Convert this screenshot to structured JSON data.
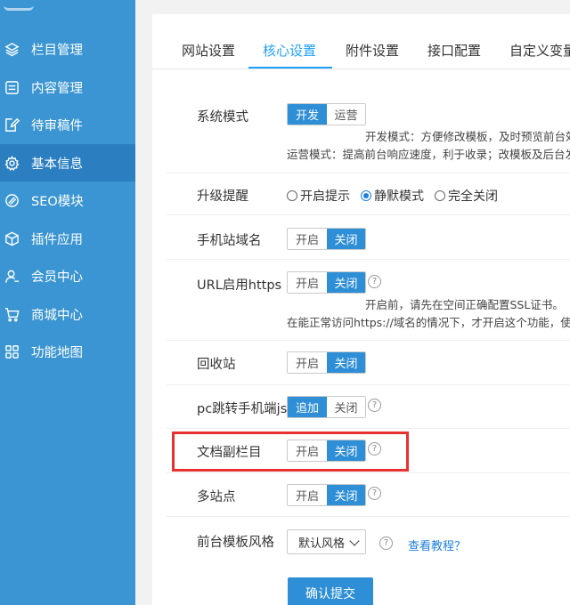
{
  "sidebar": {
    "items": [
      {
        "label": "栏目管理",
        "icon": "layers-icon",
        "active": false
      },
      {
        "label": "内容管理",
        "icon": "list-icon",
        "active": false
      },
      {
        "label": "待审稿件",
        "icon": "edit-doc-icon",
        "active": false
      },
      {
        "label": "基本信息",
        "icon": "gear-icon",
        "active": true
      },
      {
        "label": "SEO模块",
        "icon": "seo-icon",
        "active": false
      },
      {
        "label": "插件应用",
        "icon": "cube-icon",
        "active": false
      },
      {
        "label": "会员中心",
        "icon": "user-icon",
        "active": false
      },
      {
        "label": "商城中心",
        "icon": "cart-icon",
        "active": false
      },
      {
        "label": "功能地图",
        "icon": "grid-icon",
        "active": false
      }
    ]
  },
  "tabs": [
    {
      "label": "网站设置",
      "active": false
    },
    {
      "label": "核心设置",
      "active": true
    },
    {
      "label": "附件设置",
      "active": false
    },
    {
      "label": "接口配置",
      "active": false
    },
    {
      "label": "自定义变量",
      "active": false
    }
  ],
  "form": {
    "system_mode": {
      "label": "系统模式",
      "options": [
        "开发",
        "运营"
      ],
      "selected": "开发",
      "note1": "开发模式：方便修改模板，及时预览前台效",
      "note2": "运营模式：提高前台响应速度，利于收录；改模板及后台发"
    },
    "upgrade_alert": {
      "label": "升级提醒",
      "options": [
        "开启提示",
        "静默模式",
        "完全关闭"
      ],
      "selected": "静默模式"
    },
    "mobile_domain": {
      "label": "手机站域名",
      "on": "开启",
      "off": "关闭",
      "selected": "关闭"
    },
    "https": {
      "label": "URL启用https",
      "on": "开启",
      "off": "关闭",
      "selected": "关闭",
      "help": "?",
      "note1": "开启前，请先在空间正确配置SSL证书。",
      "note2": "在能正常访问https://域名的情况下，才开启这个功能，使"
    },
    "recycle": {
      "label": "回收站",
      "on": "开启",
      "off": "关闭",
      "selected": "关闭"
    },
    "pc_jump": {
      "label": "pc跳转手机端js",
      "on": "追加",
      "off": "关闭",
      "selected": "追加",
      "help": "?"
    },
    "sub_column": {
      "label": "文档副栏目",
      "on": "开启",
      "off": "关闭",
      "selected": "关闭",
      "help": "?"
    },
    "multi_site": {
      "label": "多站点",
      "on": "开启",
      "off": "关闭",
      "selected": "关闭",
      "help": "?"
    },
    "template_style": {
      "label": "前台模板风格",
      "value": "默认风格",
      "help": "?",
      "link": "查看教程？"
    },
    "submit_label": "确认提交"
  },
  "colors": {
    "sidebar_bg": "#3a95d2",
    "sidebar_active": "#2b7fc0",
    "accent": "#2e8ed6",
    "tab_active": "#1e9fff",
    "highlight": "#e8312f"
  }
}
